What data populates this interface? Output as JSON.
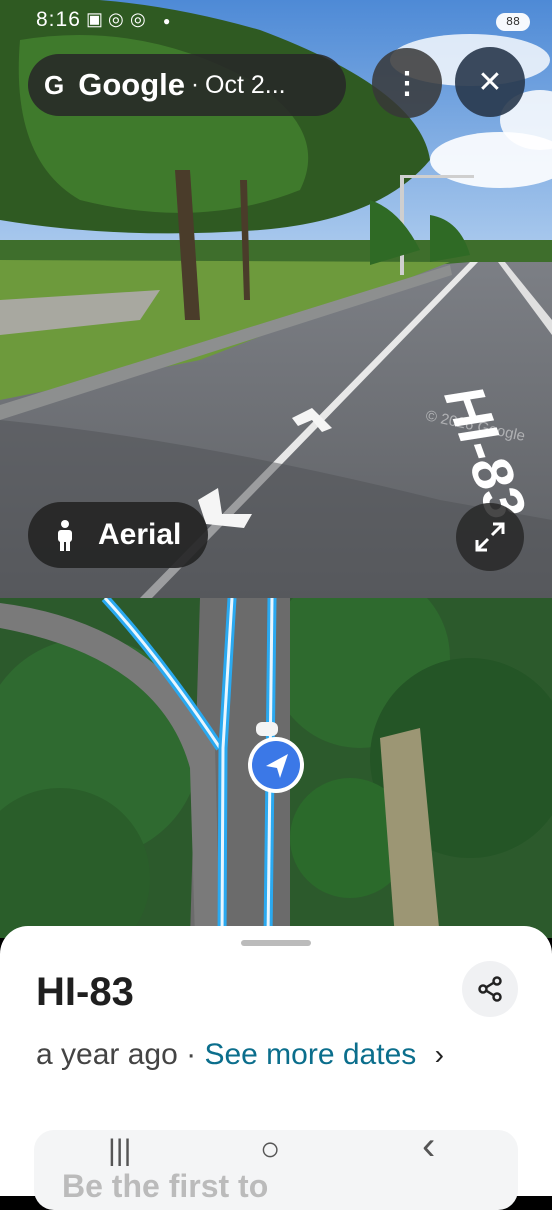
{
  "status_bar": {
    "time": "8:16",
    "icons": [
      "gallery-icon",
      "nfc-icon",
      "nfc-icon",
      "dot-icon"
    ],
    "battery": "88"
  },
  "streetview": {
    "brand_glyph": "G",
    "brand": "Google",
    "separator": "·",
    "date": "Oct 2...",
    "road_marking": "HI-83",
    "watermark": "© 2026 Google",
    "more_icon": "⋮",
    "close_icon": "✕",
    "aerial_label": "Aerial"
  },
  "sheet": {
    "title": "HI-83",
    "age": "a year ago",
    "separator": "·",
    "more_dates": "See more dates",
    "chevron": "›",
    "card_text": "Be the first to"
  },
  "nav_bar": {
    "recents": "|||",
    "home": "○",
    "back": "‹"
  },
  "colors": {
    "route_blue": "#2aa9f0",
    "location_blue": "#3b78e7",
    "link_teal": "#0b6e8c"
  }
}
